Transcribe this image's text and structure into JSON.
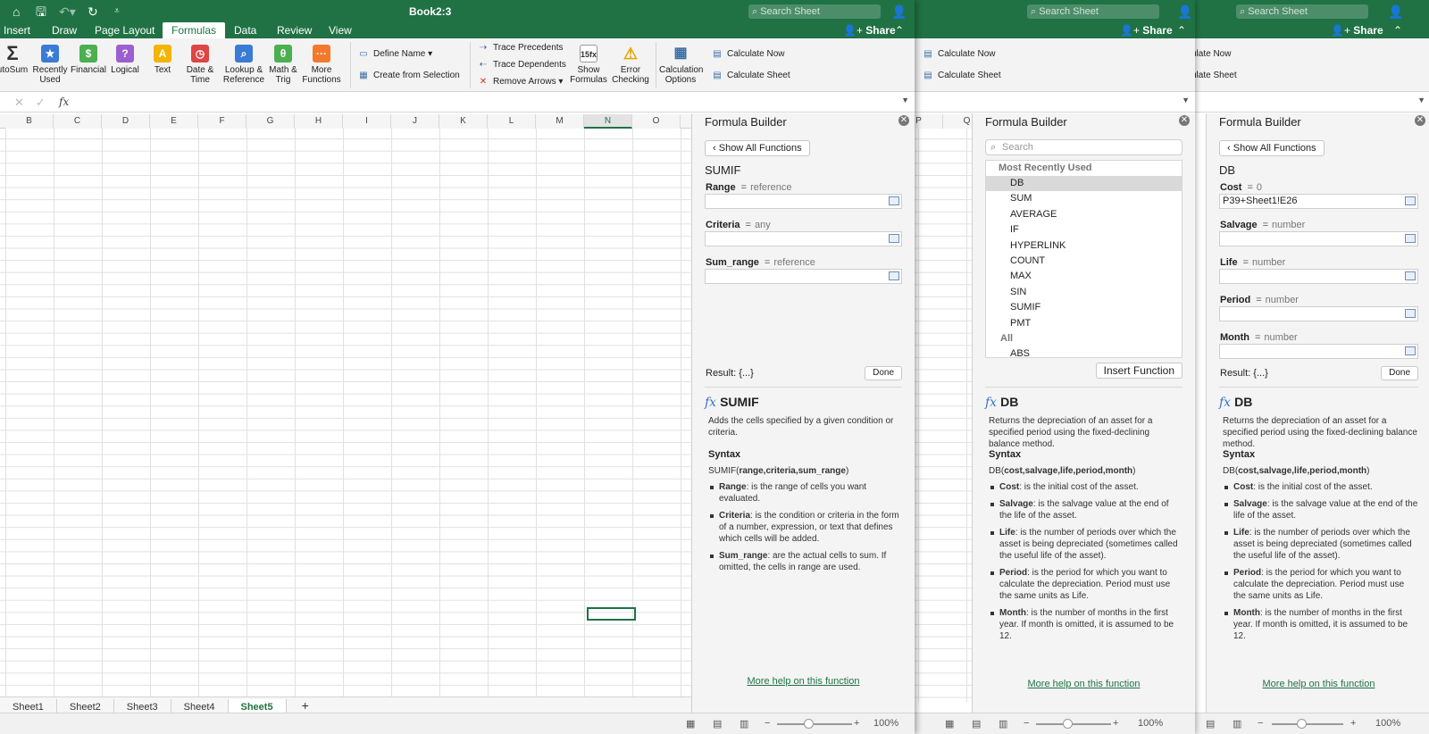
{
  "app": {
    "title": "Book2:3",
    "search_placeholder": "Search Sheet",
    "share_label": "Share",
    "accent": "#207245",
    "qat_icons": [
      "home-icon",
      "save-icon",
      "undo-icon",
      "redo-icon",
      "customize-icon"
    ]
  },
  "tabs": [
    "Insert",
    "Draw",
    "Page Layout",
    "Formulas",
    "Data",
    "Review",
    "View"
  ],
  "active_tab": "Formulas",
  "ribbon": {
    "autosum": "utoSum",
    "recently_used": "Recently Used",
    "financial": "Financial",
    "logical": "Logical",
    "text": "Text",
    "date_time": "Date & Time",
    "lookup": "Lookup & Reference",
    "math": "Math & Trig",
    "more": "More Functions",
    "define_name": "Define Name",
    "create_from_selection": "Create from Selection",
    "trace_precedents": "Trace Precedents",
    "trace_dependents": "Trace Dependents",
    "remove_arrows": "Remove Arrows",
    "show_formulas": "Show Formulas",
    "error_checking": "Error Checking",
    "calc_options": "Calculation Options",
    "calc_now": "Calculate Now",
    "calc_sheet": "Calculate Sheet",
    "calc_now_cut": "ulate Now",
    "calc_sheet_cut": "ulate Sheet"
  },
  "formula_bar": {
    "fx": "fx",
    "value": ""
  },
  "columns": [
    "B",
    "C",
    "D",
    "E",
    "F",
    "G",
    "H",
    "I",
    "J",
    "K",
    "L",
    "M",
    "N",
    "O"
  ],
  "columns2": [
    "P",
    "Q"
  ],
  "selected_column": "N",
  "sheets": [
    "Sheet1",
    "Sheet2",
    "Sheet3",
    "Sheet4",
    "Sheet5"
  ],
  "active_sheet": "Sheet5",
  "zoom": "100%",
  "panel1": {
    "title": "Formula Builder",
    "back_label": "Show All Functions",
    "function_name": "SUMIF",
    "args": [
      {
        "name": "Range",
        "eq": "=",
        "hint": "reference",
        "value": ""
      },
      {
        "name": "Criteria",
        "eq": "=",
        "hint": "any",
        "value": ""
      },
      {
        "name": "Sum_range",
        "eq": "=",
        "hint": "reference",
        "value": ""
      }
    ],
    "result": "Result: {...}",
    "done": "Done",
    "help_title": "SUMIF",
    "description": "Adds the cells specified by a given condition or criteria.",
    "syntax_label": "Syntax",
    "syntax_fn": "SUMIF(",
    "syntax_args": "range,criteria,sum_range",
    "syntax_close": ")",
    "bullets": [
      {
        "term": "Range",
        "text": ": is the range of cells you want evaluated."
      },
      {
        "term": "Criteria",
        "text": ": is the condition or criteria in the form of a number, expression, or text that defines which cells will be added."
      },
      {
        "term": "Sum_range",
        "text": ": are the actual cells to sum. If omitted, the cells in range are used."
      }
    ],
    "more_help": "More help on this function"
  },
  "panel2": {
    "title": "Formula Builder",
    "search_placeholder": "Search",
    "group_recent": "Most Recently Used",
    "recent": [
      "DB",
      "SUM",
      "AVERAGE",
      "IF",
      "HYPERLINK",
      "COUNT",
      "MAX",
      "SIN",
      "SUMIF",
      "PMT"
    ],
    "selected": "DB",
    "group_all": "All",
    "all": [
      "ABS"
    ],
    "insert_label": "Insert Function",
    "help_title": "DB",
    "description": "Returns the depreciation of an asset for a specified period using the fixed-declining balance method.",
    "syntax_label": "Syntax",
    "syntax_fn": "DB(",
    "syntax_args": "cost,salvage,life,period,month",
    "syntax_close": ")",
    "bullets": [
      {
        "term": "Cost",
        "text": ": is the initial cost of the asset."
      },
      {
        "term": "Salvage",
        "text": ": is the salvage value at the end of the life of the asset."
      },
      {
        "term": "Life",
        "text": ": is the number of periods over which the asset is being depreciated (sometimes called the useful life of the asset)."
      },
      {
        "term": "Period",
        "text": ": is the period for which you want to calculate the depreciation. Period must use the same units as Life."
      },
      {
        "term": "Month",
        "text": ": is the number of months in the first year. If month is omitted, it is assumed to be 12."
      }
    ],
    "more_help": "More help on this function"
  },
  "panel3": {
    "title": "Formula Builder",
    "back_label": "Show All Functions",
    "function_name": "DB",
    "args": [
      {
        "name": "Cost",
        "eq": "=",
        "hint": "0",
        "value": "P39+Sheet1!E26"
      },
      {
        "name": "Salvage",
        "eq": "=",
        "hint": "number",
        "value": ""
      },
      {
        "name": "Life",
        "eq": "=",
        "hint": "number",
        "value": ""
      },
      {
        "name": "Period",
        "eq": "=",
        "hint": "number",
        "value": ""
      },
      {
        "name": "Month",
        "eq": "=",
        "hint": "number",
        "value": ""
      }
    ],
    "result": "Result: {...}",
    "done": "Done",
    "help_title": "DB",
    "more_help": "More help on this function"
  }
}
